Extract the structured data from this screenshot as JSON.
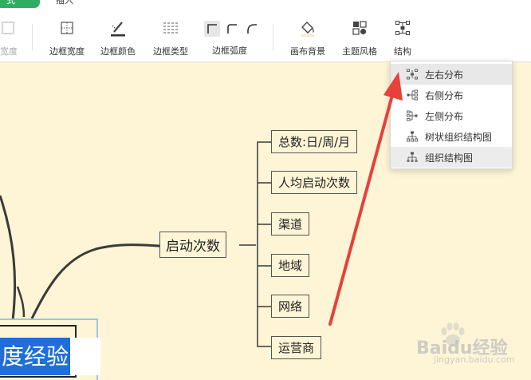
{
  "tabs": {
    "active_label": "式",
    "insert_label": "插入"
  },
  "toolbar": {
    "clipped_label": "宽度",
    "border_width": "边框宽度",
    "border_color": "边框颜色",
    "border_type": "边框类型",
    "border_radius": "边框弧度",
    "canvas_bg": "画布背景",
    "theme_style": "主题风格",
    "structure": "结构"
  },
  "structure_menu": {
    "items": [
      {
        "label": "左右分布",
        "icon": "left-right-layout-icon"
      },
      {
        "label": "右侧分布",
        "icon": "right-layout-icon"
      },
      {
        "label": "左侧分布",
        "icon": "left-layout-icon"
      },
      {
        "label": "树状组织结构图",
        "icon": "tree-org-icon"
      },
      {
        "label": "组织结构图",
        "icon": "org-chart-icon"
      }
    ]
  },
  "mindmap": {
    "root_label": "度经验",
    "branch_label": "启动次数",
    "children": [
      "总数:日/周/月",
      "人均启动次数",
      "渠道",
      "地域",
      "网络",
      "运营商"
    ]
  },
  "watermark": {
    "brand": "Baidu经验",
    "site": "jingyan.baidu.com"
  },
  "colors": {
    "accent_green": "#2fae62",
    "canvas_bg": "#fdf5d6",
    "selection_blue": "#1f6fd8",
    "arrow_red": "#e8403a"
  }
}
